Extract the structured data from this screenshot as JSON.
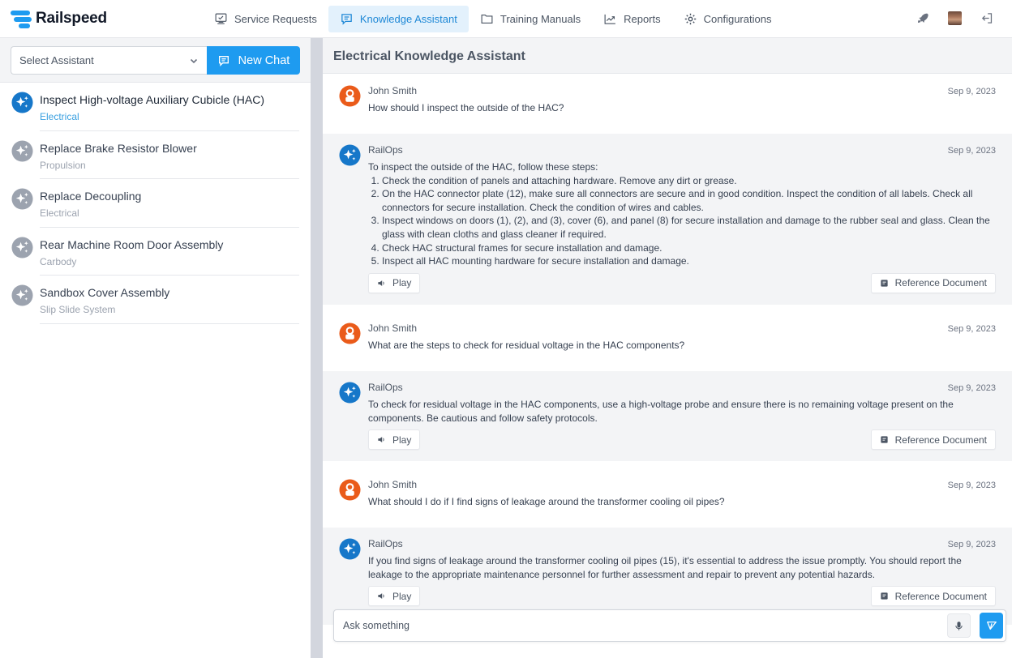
{
  "app": {
    "brand_name": "Railspeed",
    "accent_color": "#1e9bf0"
  },
  "nav": {
    "items": [
      {
        "label": "Service Requests",
        "icon": "monitor-icon",
        "active": false
      },
      {
        "label": "Knowledge Assistant",
        "icon": "chat-icon",
        "active": true
      },
      {
        "label": "Training Manuals",
        "icon": "folder-icon",
        "active": false
      },
      {
        "label": "Reports",
        "icon": "chart-line-icon",
        "active": false
      },
      {
        "label": "Configurations",
        "icon": "gear-icon",
        "active": false
      }
    ],
    "right_icons": [
      "rocket-icon",
      "user-avatar",
      "logout-icon"
    ]
  },
  "sidebar": {
    "select_placeholder": "Select Assistant",
    "new_chat_label": "New Chat",
    "chats": [
      {
        "title": "Inspect High-voltage Auxiliary Cubicle (HAC)",
        "category": "Electrical",
        "active": true
      },
      {
        "title": "Replace Brake Resistor Blower",
        "category": "Propulsion",
        "active": false
      },
      {
        "title": "Replace Decoupling",
        "category": "Electrical",
        "active": false
      },
      {
        "title": "Rear Machine Room Door Assembly",
        "category": "Carbody",
        "active": false
      },
      {
        "title": "Sandbox Cover Assembly",
        "category": "Slip Slide System",
        "active": false
      }
    ]
  },
  "main": {
    "title": "Electrical Knowledge Assistant",
    "play_label": "Play",
    "reference_label": "Reference Document",
    "messages": [
      {
        "role": "user",
        "name": "John Smith",
        "date": "Sep 9, 2023",
        "text": "How should I inspect the outside of the HAC?"
      },
      {
        "role": "bot",
        "name": "RailOps",
        "date": "Sep 9, 2023",
        "text": "To inspect the outside of the HAC, follow these steps:",
        "steps": [
          "Check the condition of panels and attaching hardware. Remove any dirt or grease.",
          "On the HAC connector plate (12), make sure all connectors are secure and in good condition. Inspect the condition of all labels. Check all connectors for secure installation. Check the condition of wires and cables.",
          "Inspect windows on doors (1), (2), and (3), cover (6), and panel (8) for secure installation and damage to the rubber seal and glass. Clean the glass with clean cloths and glass cleaner if required.",
          "Check HAC structural frames for secure installation and damage.",
          "Inspect all HAC mounting hardware for secure installation and damage."
        ]
      },
      {
        "role": "user",
        "name": "John Smith",
        "date": "Sep 9, 2023",
        "text": "What are the steps to check for residual voltage in the HAC components?"
      },
      {
        "role": "bot",
        "name": "RailOps",
        "date": "Sep 9, 2023",
        "text": "To check for residual voltage in the HAC components, use a high-voltage probe and ensure there is no remaining voltage present on the components. Be cautious and follow safety protocols."
      },
      {
        "role": "user",
        "name": "John Smith",
        "date": "Sep 9, 2023",
        "text": "What should I do if I find signs of leakage around the transformer cooling oil pipes?"
      },
      {
        "role": "bot",
        "name": "RailOps",
        "date": "Sep 9, 2023",
        "text": "If you find signs of leakage around the transformer cooling oil pipes (15), it's essential to address the issue promptly. You should report the leakage to the appropriate maintenance personnel for further assessment and repair to prevent any potential hazards."
      }
    ],
    "composer": {
      "placeholder": "Ask something",
      "value": ""
    }
  }
}
